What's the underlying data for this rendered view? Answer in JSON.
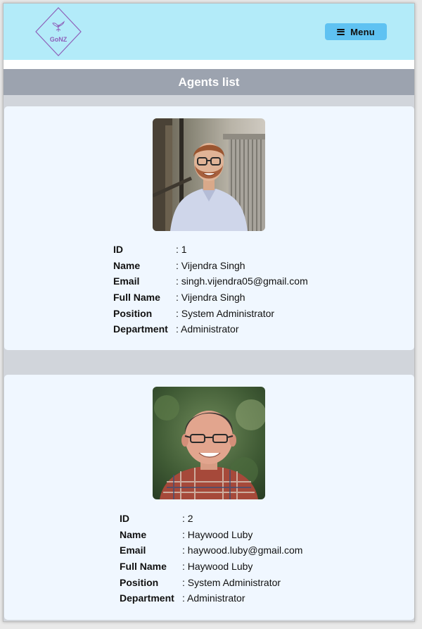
{
  "header": {
    "logo_text": "GoNZ",
    "menu_label": "Menu"
  },
  "page": {
    "title": "Agents list"
  },
  "labels": {
    "id": "ID",
    "name": "Name",
    "email": "Email",
    "full_name": "Full Name",
    "position": "Position",
    "department": "Department"
  },
  "agents": [
    {
      "id": ": 1",
      "name": ": Vijendra Singh",
      "email": ": singh.vijendra05@gmail.com",
      "full_name": ": Vijendra Singh",
      "position": ": System Administrator",
      "department": ": Administrator"
    },
    {
      "id": ": 2",
      "name": ": Haywood Luby",
      "email": ": haywood.luby@gmail.com",
      "full_name": ": Haywood Luby",
      "position": ": System Administrator",
      "department": ": Administrator"
    }
  ],
  "colors": {
    "header_bg": "#b3ebf9",
    "menu_button": "#5fc2f2",
    "title_bar": "#9ca3af",
    "page_bg": "#d1d5db",
    "card_bg": "#f0f7ff",
    "logo_purple": "#8e60b9"
  }
}
